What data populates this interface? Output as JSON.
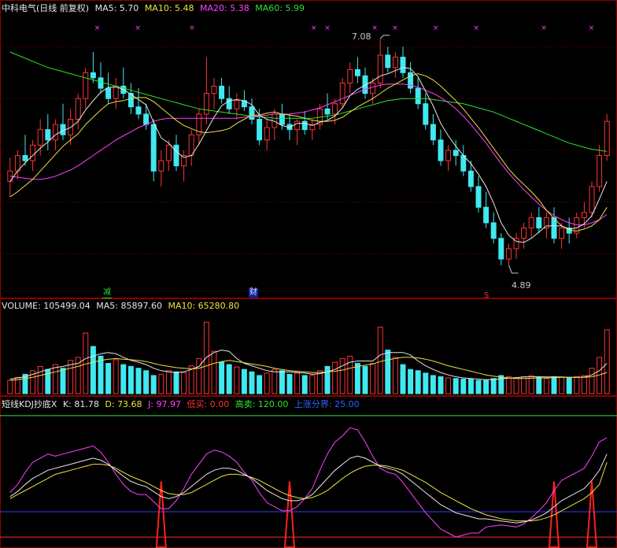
{
  "price_header": {
    "title": "中科电气(日线 前复权)",
    "ma5": "MA5: 5.70",
    "ma10": "MA10: 5.48",
    "ma20": "MA20: 5.38",
    "ma60": "MA60: 5.99"
  },
  "volume_header": {
    "title": "VOLUME: 105499.04",
    "ma5": "MA5: 85897.60",
    "ma10": "MA10: 65280.80"
  },
  "kdj_header": {
    "title": "短线KDJ抄底X",
    "k": "K: 81.78",
    "d": "D: 73.68",
    "j": "J: 97.97",
    "low_buy": "低买: 0.00",
    "high_sell": "高卖: 120.00",
    "rise_line": "上涨分界: 25.00"
  },
  "annotations": {
    "high": "7.08",
    "low": "4.89",
    "event_reduce": "减",
    "event_finance": "财",
    "event_s": "S"
  },
  "colors": {
    "up": "#ff3333",
    "down": "#40e8f0",
    "ma5": "#e8e8e8",
    "ma10": "#f0e040",
    "ma20": "#ff40ff",
    "ma60": "#30e030",
    "grid": "#8a0000"
  },
  "chart_data": [
    {
      "type": "candlestick",
      "title": "中科电气(日线 前复权)",
      "ylim": [
        4.6,
        7.3
      ],
      "grid": true,
      "ohlc": [
        [
          5.7,
          5.93,
          5.55,
          5.8
        ],
        [
          5.8,
          6.0,
          5.72,
          5.95
        ],
        [
          5.95,
          6.15,
          5.85,
          5.9
        ],
        [
          5.9,
          6.1,
          5.8,
          6.05
        ],
        [
          6.05,
          6.3,
          5.95,
          6.2
        ],
        [
          6.2,
          6.35,
          6.0,
          6.1
        ],
        [
          6.1,
          6.3,
          6.0,
          6.25
        ],
        [
          6.25,
          6.45,
          6.1,
          6.15
        ],
        [
          6.15,
          6.4,
          6.05,
          6.3
        ],
        [
          6.3,
          6.55,
          6.2,
          6.5
        ],
        [
          6.5,
          6.8,
          6.4,
          6.75
        ],
        [
          6.75,
          6.95,
          6.65,
          6.7
        ],
        [
          6.7,
          6.85,
          6.55,
          6.6
        ],
        [
          6.6,
          6.75,
          6.45,
          6.5
        ],
        [
          6.5,
          6.7,
          6.4,
          6.62
        ],
        [
          6.62,
          6.8,
          6.5,
          6.55
        ],
        [
          6.55,
          6.65,
          6.35,
          6.42
        ],
        [
          6.42,
          6.6,
          6.3,
          6.35
        ],
        [
          6.35,
          6.45,
          6.2,
          6.25
        ],
        [
          6.25,
          6.3,
          5.7,
          5.8
        ],
        [
          5.8,
          6.0,
          5.65,
          5.9
        ],
        [
          5.9,
          6.1,
          5.8,
          6.05
        ],
        [
          6.05,
          6.15,
          5.8,
          5.85
        ],
        [
          5.85,
          6.0,
          5.7,
          5.95
        ],
        [
          5.95,
          6.2,
          5.85,
          6.15
        ],
        [
          6.15,
          6.4,
          6.05,
          6.35
        ],
        [
          6.35,
          6.9,
          6.25,
          6.55
        ],
        [
          6.55,
          6.7,
          6.4,
          6.62
        ],
        [
          6.62,
          6.7,
          6.45,
          6.5
        ],
        [
          6.5,
          6.62,
          6.35,
          6.4
        ],
        [
          6.4,
          6.55,
          6.3,
          6.48
        ],
        [
          6.48,
          6.58,
          6.38,
          6.42
        ],
        [
          6.42,
          6.5,
          6.25,
          6.3
        ],
        [
          6.3,
          6.4,
          6.05,
          6.1
        ],
        [
          6.1,
          6.3,
          6.0,
          6.22
        ],
        [
          6.22,
          6.4,
          6.1,
          6.35
        ],
        [
          6.35,
          6.45,
          6.2,
          6.25
        ],
        [
          6.25,
          6.35,
          6.1,
          6.2
        ],
        [
          6.2,
          6.3,
          6.05,
          6.28
        ],
        [
          6.28,
          6.38,
          6.15,
          6.2
        ],
        [
          6.2,
          6.3,
          6.1,
          6.25
        ],
        [
          6.25,
          6.45,
          6.2,
          6.4
        ],
        [
          6.4,
          6.55,
          6.3,
          6.35
        ],
        [
          6.35,
          6.5,
          6.25,
          6.45
        ],
        [
          6.45,
          6.7,
          6.4,
          6.65
        ],
        [
          6.65,
          6.85,
          6.55,
          6.78
        ],
        [
          6.78,
          6.9,
          6.65,
          6.72
        ],
        [
          6.72,
          6.8,
          6.5,
          6.55
        ],
        [
          6.55,
          6.7,
          6.45,
          6.65
        ],
        [
          6.65,
          7.08,
          6.6,
          6.92
        ],
        [
          6.92,
          7.0,
          6.75,
          6.8
        ],
        [
          6.8,
          6.95,
          6.7,
          6.9
        ],
        [
          6.9,
          7.0,
          6.7,
          6.75
        ],
        [
          6.75,
          6.85,
          6.55,
          6.6
        ],
        [
          6.6,
          6.7,
          6.4,
          6.45
        ],
        [
          6.45,
          6.55,
          6.2,
          6.25
        ],
        [
          6.25,
          6.35,
          6.05,
          6.1
        ],
        [
          6.1,
          6.2,
          5.85,
          5.9
        ],
        [
          5.9,
          6.05,
          5.8,
          6.0
        ],
        [
          6.0,
          6.1,
          5.85,
          5.95
        ],
        [
          5.95,
          6.05,
          5.75,
          5.8
        ],
        [
          5.8,
          5.9,
          5.6,
          5.65
        ],
        [
          5.65,
          5.75,
          5.4,
          5.45
        ],
        [
          5.45,
          5.6,
          5.25,
          5.3
        ],
        [
          5.3,
          5.4,
          5.1,
          5.15
        ],
        [
          5.15,
          5.2,
          4.89,
          4.95
        ],
        [
          4.95,
          5.1,
          4.89,
          5.05
        ],
        [
          5.05,
          5.2,
          4.95,
          5.15
        ],
        [
          5.15,
          5.3,
          5.05,
          5.25
        ],
        [
          5.25,
          5.4,
          5.15,
          5.35
        ],
        [
          5.35,
          5.45,
          5.2,
          5.25
        ],
        [
          5.25,
          5.4,
          5.15,
          5.35
        ],
        [
          5.35,
          5.45,
          5.1,
          5.15
        ],
        [
          5.15,
          5.3,
          5.05,
          5.25
        ],
        [
          5.25,
          5.35,
          5.1,
          5.2
        ],
        [
          5.2,
          5.4,
          5.15,
          5.35
        ],
        [
          5.35,
          5.5,
          5.25,
          5.4
        ],
        [
          5.4,
          5.7,
          5.35,
          5.65
        ],
        [
          5.65,
          6.05,
          5.6,
          5.95
        ],
        [
          5.95,
          6.35,
          5.9,
          6.28
        ]
      ],
      "ma5": [
        5.7,
        5.8,
        5.88,
        5.95,
        6.02,
        6.08,
        6.15,
        6.19,
        6.22,
        6.28,
        6.39,
        6.48,
        6.56,
        6.61,
        6.61,
        6.59,
        6.54,
        6.49,
        6.44,
        6.27,
        6.12,
        6.07,
        5.99,
        5.93,
        5.95,
        6.06,
        6.19,
        6.32,
        6.43,
        6.48,
        6.49,
        6.48,
        6.44,
        6.34,
        6.3,
        6.28,
        6.24,
        6.22,
        6.26,
        6.26,
        6.24,
        6.27,
        6.29,
        6.33,
        6.41,
        6.53,
        6.59,
        6.63,
        6.67,
        6.72,
        6.74,
        6.77,
        6.8,
        6.79,
        6.71,
        6.57,
        6.43,
        6.26,
        6.14,
        6.04,
        5.95,
        5.87,
        5.77,
        5.65,
        5.49,
        5.3,
        5.18,
        5.12,
        5.11,
        5.15,
        5.21,
        5.27,
        5.27,
        5.27,
        5.24,
        5.25,
        5.29,
        5.37,
        5.53,
        5.7
      ],
      "ma10": [
        5.55,
        5.6,
        5.66,
        5.72,
        5.8,
        5.88,
        5.96,
        6.04,
        6.1,
        6.16,
        6.25,
        6.32,
        6.39,
        6.45,
        6.47,
        6.48,
        6.5,
        6.51,
        6.51,
        6.47,
        6.41,
        6.35,
        6.29,
        6.24,
        6.21,
        6.18,
        6.17,
        6.18,
        6.19,
        6.21,
        6.26,
        6.3,
        6.34,
        6.34,
        6.36,
        6.37,
        6.35,
        6.34,
        6.33,
        6.31,
        6.29,
        6.28,
        6.28,
        6.29,
        6.32,
        6.37,
        6.42,
        6.46,
        6.5,
        6.55,
        6.6,
        6.64,
        6.68,
        6.72,
        6.74,
        6.72,
        6.68,
        6.62,
        6.55,
        6.48,
        6.4,
        6.31,
        6.22,
        6.12,
        6.02,
        5.92,
        5.82,
        5.74,
        5.67,
        5.6,
        5.52,
        5.42,
        5.34,
        5.27,
        5.23,
        5.22,
        5.24,
        5.27,
        5.33,
        5.45
      ],
      "ma20": [
        5.75,
        5.74,
        5.73,
        5.72,
        5.72,
        5.73,
        5.75,
        5.78,
        5.81,
        5.85,
        5.9,
        5.95,
        6.0,
        6.05,
        6.1,
        6.14,
        6.18,
        6.22,
        6.25,
        6.28,
        6.3,
        6.31,
        6.31,
        6.31,
        6.31,
        6.31,
        6.31,
        6.31,
        6.31,
        6.31,
        6.31,
        6.32,
        6.33,
        6.33,
        6.34,
        6.35,
        6.35,
        6.35,
        6.36,
        6.37,
        6.39,
        6.41,
        6.44,
        6.47,
        6.5,
        6.53,
        6.56,
        6.59,
        6.61,
        6.63,
        6.64,
        6.64,
        6.64,
        6.63,
        6.61,
        6.58,
        6.55,
        6.51,
        6.46,
        6.4,
        6.33,
        6.25,
        6.16,
        6.07,
        5.97,
        5.87,
        5.78,
        5.7,
        5.62,
        5.55,
        5.48,
        5.42,
        5.37,
        5.33,
        5.3,
        5.28,
        5.28,
        5.3,
        5.33,
        5.38
      ],
      "ma60": [
        6.95,
        6.92,
        6.89,
        6.86,
        6.83,
        6.8,
        6.78,
        6.76,
        6.74,
        6.72,
        6.7,
        6.68,
        6.66,
        6.64,
        6.62,
        6.6,
        6.58,
        6.56,
        6.54,
        6.52,
        6.5,
        6.48,
        6.46,
        6.44,
        6.42,
        6.4,
        6.39,
        6.38,
        6.37,
        6.36,
        6.35,
        6.34,
        6.33,
        6.32,
        6.32,
        6.31,
        6.31,
        6.31,
        6.31,
        6.31,
        6.31,
        6.32,
        6.33,
        6.34,
        6.36,
        6.38,
        6.4,
        6.42,
        6.44,
        6.46,
        6.48,
        6.49,
        6.5,
        6.5,
        6.5,
        6.5,
        6.49,
        6.48,
        6.47,
        6.46,
        6.45,
        6.43,
        6.41,
        6.39,
        6.37,
        6.34,
        6.31,
        6.28,
        6.25,
        6.22,
        6.19,
        6.16,
        6.13,
        6.1,
        6.07,
        6.05,
        6.03,
        6.01,
        6.0,
        5.99
      ]
    },
    {
      "type": "bar",
      "title": "VOLUME",
      "ylim": [
        0,
        130000
      ],
      "values": [
        22000,
        27000,
        32000,
        38000,
        45000,
        40000,
        48000,
        42000,
        55000,
        60000,
        100000,
        78000,
        62000,
        50000,
        56000,
        48000,
        45000,
        42000,
        38000,
        30000,
        32000,
        38000,
        36000,
        35000,
        46000,
        58000,
        118000,
        70000,
        52000,
        48000,
        44000,
        40000,
        36000,
        30000,
        34000,
        40000,
        38000,
        32000,
        34000,
        30000,
        30000,
        38000,
        45000,
        52000,
        58000,
        62000,
        50000,
        45000,
        50000,
        110000,
        72000,
        60000,
        48000,
        40000,
        38000,
        34000,
        30000,
        28000,
        26000,
        25000,
        24000,
        24000,
        22000,
        22000,
        25000,
        30000,
        28000,
        26000,
        28000,
        30000,
        27000,
        25000,
        28000,
        27000,
        26000,
        28000,
        30000,
        42000,
        60000,
        105499
      ],
      "ma5": [
        24000,
        26000,
        28000,
        32000,
        36000,
        40000,
        43000,
        45000,
        48000,
        50000,
        58000,
        62000,
        66000,
        68000,
        66000,
        60000,
        55000,
        52000,
        48000,
        42000,
        38000,
        36000,
        35000,
        36000,
        40000,
        45000,
        60000,
        68000,
        72000,
        70000,
        58000,
        50000,
        46000,
        42000,
        38000,
        36000,
        36000,
        36000,
        35000,
        34000,
        32000,
        33000,
        36000,
        40000,
        46000,
        52000,
        54000,
        54000,
        54000,
        64000,
        68000,
        68000,
        68000,
        64000,
        54000,
        46000,
        40000,
        35000,
        31000,
        28000,
        26000,
        25000,
        24000,
        23000,
        23500,
        24500,
        25500,
        26500,
        27500,
        28000,
        28000,
        27500,
        27500,
        27500,
        27000,
        27000,
        27500,
        31000,
        38000,
        50000
      ],
      "ma10": [
        22000,
        23000,
        25000,
        27000,
        30000,
        33000,
        36000,
        39000,
        42000,
        45000,
        49000,
        52000,
        55000,
        57000,
        58000,
        57000,
        56000,
        55000,
        53000,
        50000,
        47000,
        45000,
        43000,
        42000,
        41000,
        42000,
        46000,
        50000,
        53000,
        55000,
        53000,
        51000,
        49000,
        47000,
        45000,
        42000,
        40000,
        38000,
        37000,
        36000,
        35000,
        35000,
        36000,
        37000,
        39000,
        42000,
        45000,
        47000,
        49000,
        53000,
        56000,
        58000,
        60000,
        60000,
        59000,
        57000,
        54000,
        50000,
        46000,
        43000,
        40000,
        37000,
        34000,
        31000,
        29000,
        27000,
        26000,
        25000,
        25000,
        25500,
        26000,
        26000,
        26500,
        27000,
        27000,
        27000,
        27000,
        28000,
        31000,
        35000
      ]
    },
    {
      "type": "line",
      "title": "短线KDJ抄底X",
      "ylim": [
        -10,
        130
      ],
      "x": "same 80 trading days as price panel",
      "K": [
        40,
        45,
        52,
        58,
        62,
        66,
        68,
        70,
        72,
        74,
        76,
        78,
        76,
        72,
        66,
        60,
        55,
        52,
        50,
        45,
        40,
        38,
        40,
        44,
        50,
        56,
        62,
        66,
        68,
        68,
        66,
        62,
        58,
        52,
        46,
        42,
        38,
        36,
        36,
        38,
        42,
        50,
        58,
        66,
        72,
        78,
        80,
        78,
        74,
        70,
        68,
        66,
        62,
        56,
        50,
        44,
        38,
        32,
        28,
        24,
        22,
        20,
        18,
        18,
        17,
        16,
        15,
        14,
        15,
        17,
        20,
        24,
        30,
        36,
        40,
        44,
        48,
        56,
        66,
        82
      ],
      "D": [
        38,
        42,
        46,
        50,
        54,
        58,
        62,
        64,
        66,
        68,
        70,
        72,
        72,
        71,
        68,
        64,
        60,
        57,
        54,
        50,
        46,
        43,
        42,
        42,
        44,
        48,
        52,
        56,
        60,
        62,
        62,
        61,
        59,
        56,
        52,
        48,
        44,
        41,
        39,
        38,
        39,
        42,
        46,
        52,
        58,
        63,
        67,
        70,
        71,
        71,
        70,
        68,
        66,
        62,
        58,
        54,
        49,
        44,
        40,
        36,
        32,
        28,
        25,
        22,
        20,
        18,
        17,
        16,
        16,
        16,
        17,
        19,
        22,
        26,
        30,
        34,
        38,
        44,
        52,
        74
      ],
      "J": [
        44,
        52,
        64,
        74,
        78,
        82,
        80,
        82,
        84,
        86,
        88,
        90,
        84,
        74,
        62,
        52,
        45,
        42,
        42,
        35,
        28,
        28,
        36,
        48,
        62,
        72,
        82,
        86,
        84,
        80,
        74,
        64,
        56,
        44,
        34,
        30,
        26,
        26,
        30,
        38,
        48,
        66,
        82,
        94,
        100,
        108,
        106,
        94,
        80,
        68,
        64,
        62,
        54,
        44,
        34,
        24,
        16,
        8,
        4,
        0,
        2,
        4,
        4,
        10,
        11,
        12,
        11,
        10,
        13,
        19,
        26,
        34,
        46,
        56,
        60,
        64,
        68,
        80,
        94,
        98
      ],
      "buy_signal_days": [
        20,
        37,
        72,
        77
      ],
      "low_buy": 0,
      "high_sell": 120,
      "rise_line": 25
    }
  ]
}
